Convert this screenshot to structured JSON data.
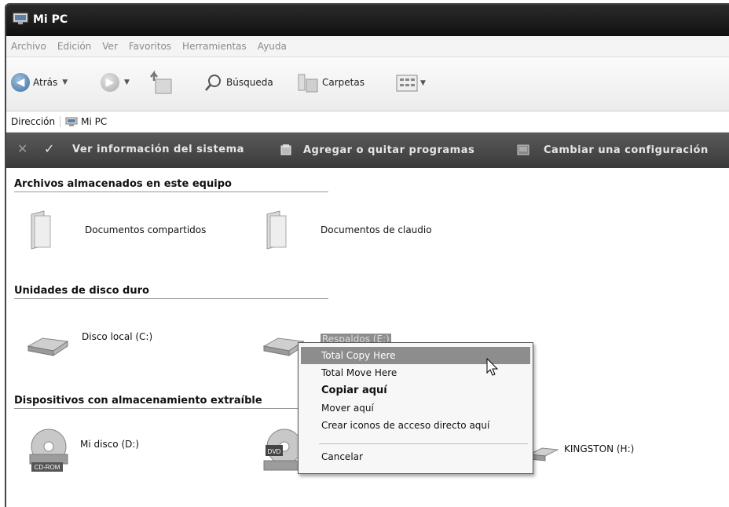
{
  "window": {
    "title": "Mi PC"
  },
  "menu": [
    "Archivo",
    "Edición",
    "Ver",
    "Favoritos",
    "Herramientas",
    "Ayuda"
  ],
  "toolbar": {
    "back_label": "Atrás",
    "search_label": "Búsqueda",
    "folders_label": "Carpetas"
  },
  "address": {
    "label": "Dirección",
    "value": "Mi PC"
  },
  "tasks": {
    "view_info": "Ver información del sistema",
    "add_remove": "Agregar o quitar programas",
    "change_setting": "Cambiar una configuración"
  },
  "sections": {
    "stored_files": "Archivos almacenados en este equipo",
    "hard_drives": "Unidades de disco duro",
    "removable": "Dispositivos con almacenamiento extraíble"
  },
  "items": {
    "shared_docs": "Documentos compartidos",
    "claudio_docs": "Documentos de claudio",
    "local_disk": "Disco local (C:)",
    "backups_disk": "Respaldos (E:)",
    "my_disc": "Mi disco (D:)",
    "kingston": "KINGSTON (H:)",
    "cdrom_badge": "CD-ROM",
    "dvd_badge": "DVD"
  },
  "context_menu": {
    "total_copy": "Total Copy Here",
    "total_move": "Total Move Here",
    "copy_here": "Copiar aquí",
    "move_here": "Mover aquí",
    "create_shortcuts": "Crear iconos de acceso directo aquí",
    "cancel": "Cancelar"
  },
  "colors": {
    "titlebar": "#1a1a1a",
    "taskbar": "#4a4a4a",
    "highlight": "#8d8d8d",
    "back_button": "#3f6f9e"
  }
}
